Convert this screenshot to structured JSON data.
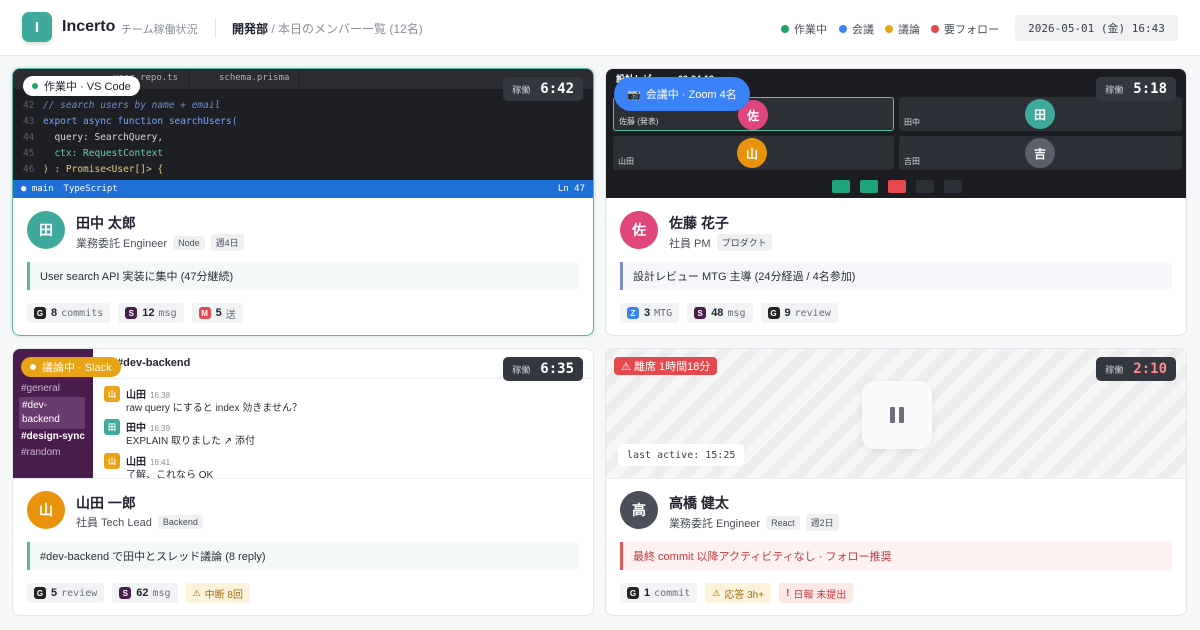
{
  "header": {
    "logo_letter": "I",
    "app_name": "Incerto",
    "app_subtitle": "チーム稼働状況",
    "dept": "開発部",
    "dept_desc": " / 本日のメンバー一覧 (12名)",
    "legend": [
      {
        "label": "作業中",
        "color": "#22a06b"
      },
      {
        "label": "会議",
        "color": "#3b82f6"
      },
      {
        "label": "議論",
        "color": "#e8a317"
      },
      {
        "label": "要フォロー",
        "color": "#e5484d"
      }
    ],
    "datetime": "2026-05-01 (金) 16:43"
  },
  "timer_label": "稼働",
  "cards": [
    {
      "pill": "作業中 · VS Code",
      "timer": "6:42",
      "code": {
        "tabs": [
          "user.repo.ts",
          "schema.prisma"
        ],
        "lines": [
          {
            "n": "42",
            "text": "// search users by name + email"
          },
          {
            "n": "43",
            "text": "export async function searchUsers("
          },
          {
            "n": "44",
            "text": "  query: SearchQuery,"
          },
          {
            "n": "45",
            "text": "  ctx: RequestContext"
          },
          {
            "n": "46",
            "text": ") : Promise<User[]> {"
          }
        ],
        "branch": "main",
        "lang": "TypeScript",
        "position": "Ln 47"
      },
      "avatar": "田",
      "avatar_color": "#3fa99c",
      "name": "田中 太郎",
      "role": "業務委託 Engineer",
      "tags": [
        "Node",
        "週4日"
      ],
      "status": "User search API 実装に集中 (47分継続)",
      "metrics": [
        {
          "icon": "G",
          "icon_color": "#222",
          "value": "8",
          "unit": "commits"
        },
        {
          "icon": "S",
          "icon_color": "#4a1d4e",
          "value": "12",
          "unit": "msg"
        },
        {
          "icon": "M",
          "icon_color": "#e5484d",
          "value": "5",
          "unit": "送"
        }
      ]
    },
    {
      "pill": "会議中 · Zoom 4名",
      "timer": "5:18",
      "zoom": {
        "header_text": "設計レビュー · 00:24:12",
        "participants": [
          {
            "name": "佐藤 (発表)",
            "initial": "佐",
            "color": "#e0457b"
          },
          {
            "name": "田中",
            "initial": "田",
            "color": "#3fa99c"
          },
          {
            "name": "山田",
            "initial": "山",
            "color": "#e8920d"
          },
          {
            "name": "吉田",
            "initial": "吉",
            "color": "#5a5f6a"
          }
        ]
      },
      "avatar": "佐",
      "avatar_color": "#e0457b",
      "name": "佐藤 花子",
      "role": "社員 PM",
      "tags": [
        "プロダクト"
      ],
      "status": "設計レビュー MTG 主導 (24分経過 / 4名参加)",
      "metrics": [
        {
          "icon": "Z",
          "icon_color": "#3b82f6",
          "value": "3",
          "unit": "MTG"
        },
        {
          "icon": "S",
          "icon_color": "#4a1d4e",
          "value": "48",
          "unit": "msg"
        },
        {
          "icon": "G",
          "icon_color": "#222",
          "value": "9",
          "unit": "review"
        }
      ]
    },
    {
      "pill": "議論中 · Slack",
      "timer": "6:35",
      "slack": {
        "channel_title": "#dev-backend",
        "channels": [
          "#general",
          "#dev-backend",
          "#design-sync",
          "#random"
        ],
        "messages": [
          {
            "initial": "山",
            "color": "#e8a317",
            "name": "山田",
            "time": "16:38",
            "text": "raw query にすると index 効きません？"
          },
          {
            "initial": "田",
            "color": "#3fa99c",
            "name": "田中",
            "time": "16:39",
            "text": "EXPLAIN 取りました ↗ 添付"
          },
          {
            "initial": "山",
            "color": "#e8a317",
            "name": "山田",
            "time": "16:41",
            "text": "了解、これなら OK"
          }
        ]
      },
      "avatar": "山",
      "avatar_color": "#e8920d",
      "name": "山田 一郎",
      "role": "社員 Tech Lead",
      "tags": [
        "Backend"
      ],
      "status": "#dev-backend で田中とスレッド議論 (8 reply)",
      "metrics": [
        {
          "icon": "G",
          "icon_color": "#222",
          "value": "5",
          "unit": "review"
        },
        {
          "icon": "S",
          "icon_color": "#4a1d4e",
          "value": "62",
          "unit": "msg"
        },
        {
          "icon": "⚠",
          "value": "",
          "unit": "中断 8回",
          "kind": "amber"
        }
      ]
    },
    {
      "pill": "⚠ 離席 1時間18分",
      "timer": "2:10",
      "away": {
        "last_active": "last active: 15:25"
      },
      "avatar": "高",
      "avatar_color": "#4a4f5a",
      "name": "高橋 健太",
      "role": "業務委託 Engineer",
      "tags": [
        "React",
        "週2日"
      ],
      "status": "最終 commit 以降アクティビティなし · フォロー推奨",
      "metrics": [
        {
          "icon": "G",
          "icon_color": "#222",
          "value": "1",
          "unit": "commit"
        },
        {
          "icon": "⚠",
          "value": "",
          "unit": "応答 3h+",
          "kind": "amber"
        },
        {
          "icon": "!",
          "value": "",
          "unit": "日報 未提出",
          "kind": "red"
        }
      ]
    }
  ]
}
